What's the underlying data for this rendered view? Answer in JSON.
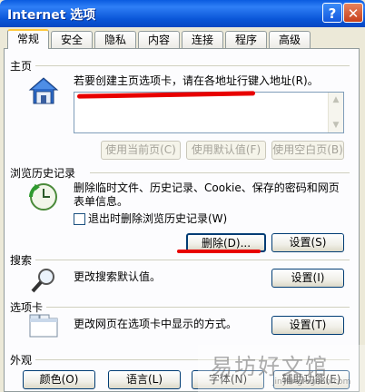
{
  "window": {
    "title": "Internet 选项",
    "help_label": "?",
    "close_label": "✕"
  },
  "tabs": [
    {
      "label": "常规",
      "active": true
    },
    {
      "label": "安全"
    },
    {
      "label": "隐私"
    },
    {
      "label": "内容"
    },
    {
      "label": "连接"
    },
    {
      "label": "程序"
    },
    {
      "label": "高级"
    }
  ],
  "home": {
    "group_label": "主页",
    "description": "若要创建主页选项卡，请在各地址行键入地址(R)。",
    "use_current": "使用当前页(C)",
    "use_default": "使用默认值(F)",
    "use_blank": "使用空白页(B)"
  },
  "history": {
    "group_label": "浏览历史记录",
    "description_line1": "删除临时文件、历史记录、Cookie、保存的密码和网页",
    "description_line2": "表单信息。",
    "checkbox_label": "退出时删除浏览历史记录(W)",
    "delete_button": "删除(D)...",
    "settings_button": "设置(S)"
  },
  "search": {
    "group_label": "搜索",
    "description": "更改搜索默认值。",
    "settings_button": "设置(I)"
  },
  "tabs_section": {
    "group_label": "选项卡",
    "description": "更改网页在选项卡中显示的方式。",
    "settings_button": "设置(T)"
  },
  "appearance": {
    "group_label": "外观",
    "colors_button": "颜色(O)",
    "languages_button": "语言(L)",
    "fonts_button": "字体(N)",
    "accessibility_button": "辅助功能(E)"
  },
  "watermark": {
    "text": "易坊好文馆",
    "small": "jinyangfaguan.com"
  },
  "icons": [
    "house-icon",
    "history-clock-icon",
    "magnifier-icon",
    "tabs-window-icon"
  ],
  "colors": {
    "annotation_red": "#e80000",
    "titlebar_blue": "#0a56d8"
  }
}
